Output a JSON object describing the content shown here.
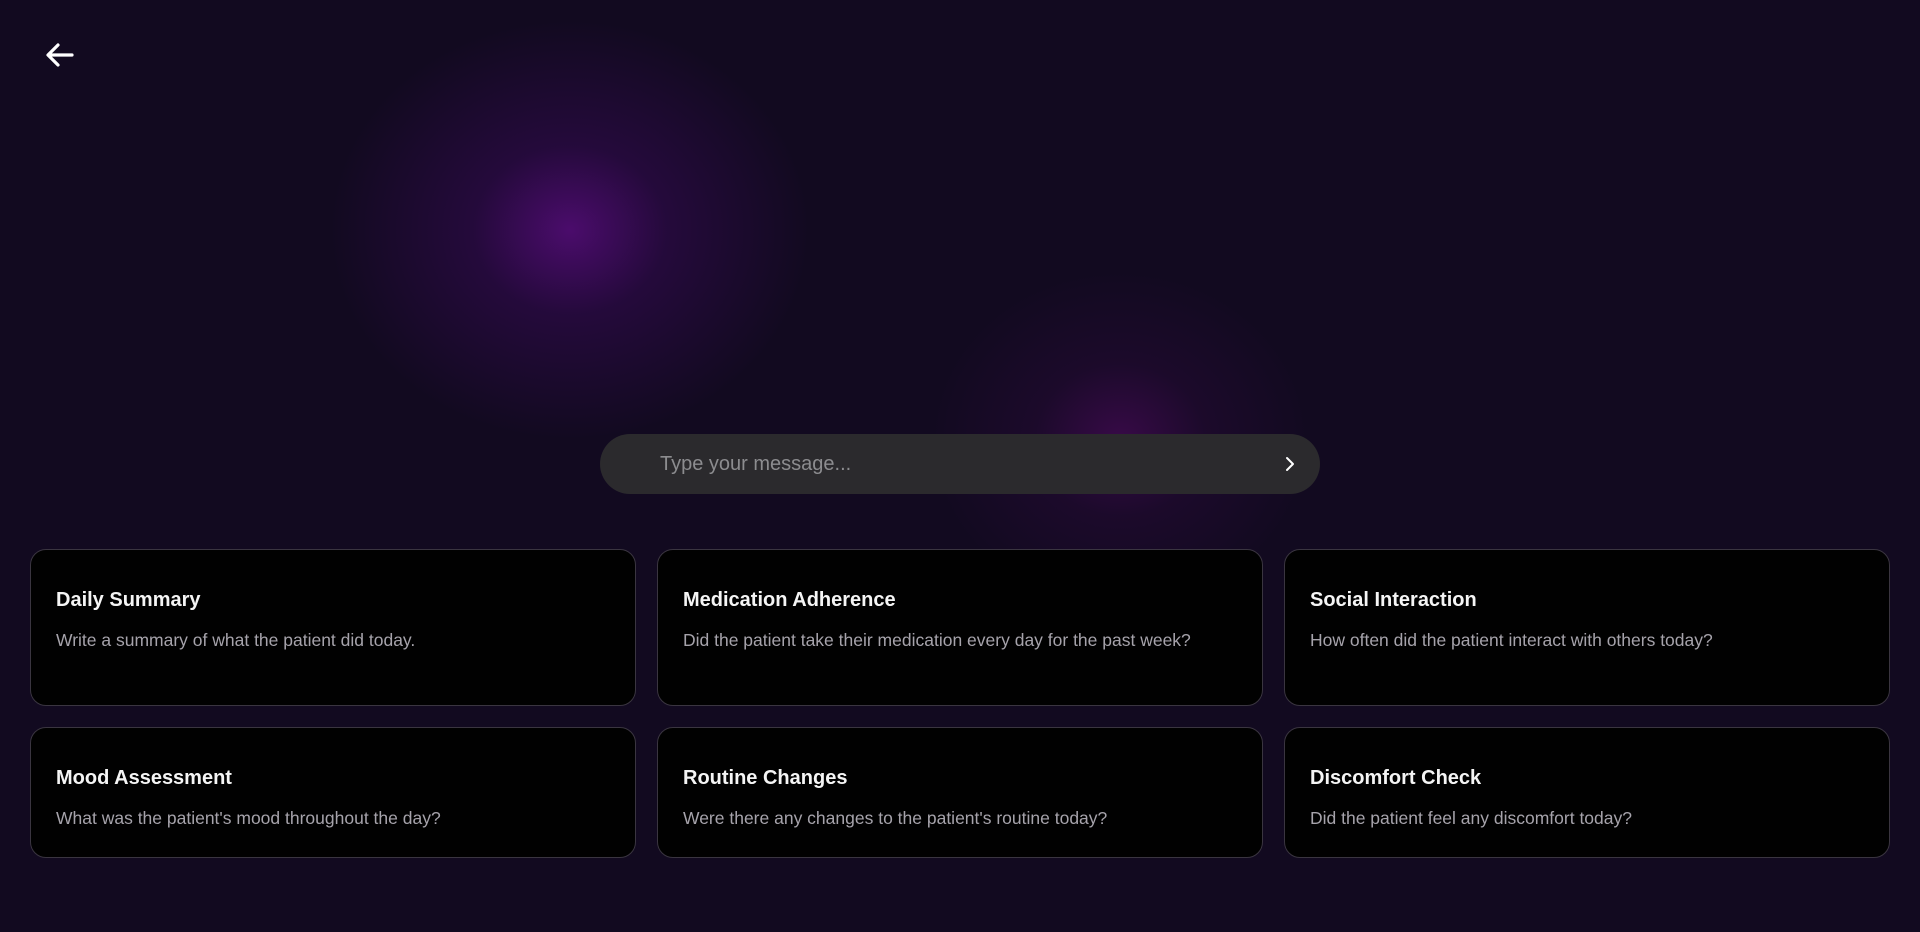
{
  "back_button": {
    "icon": "arrow-left-icon",
    "color": "#ffffff"
  },
  "chat_input": {
    "value": "",
    "placeholder": "Type your message...",
    "send_icon": "chevron-right-icon"
  },
  "theme": {
    "background": "#120a20",
    "glow_color": "#4e0c70",
    "card_background": "#010101",
    "input_background": "#2b2a2d"
  },
  "prompt_cards": [
    {
      "title": "Daily Summary",
      "description": "Write a summary of what the patient did today."
    },
    {
      "title": "Medication Adherence",
      "description": "Did the patient take their medication every day for the past week?"
    },
    {
      "title": "Social Interaction",
      "description": "How often did the patient interact with others today?"
    },
    {
      "title": "Mood Assessment",
      "description": "What was the patient's mood throughout the day?"
    },
    {
      "title": "Routine Changes",
      "description": "Were there any changes to the patient's routine today?"
    },
    {
      "title": "Discomfort Check",
      "description": "Did the patient feel any discomfort today?"
    }
  ]
}
